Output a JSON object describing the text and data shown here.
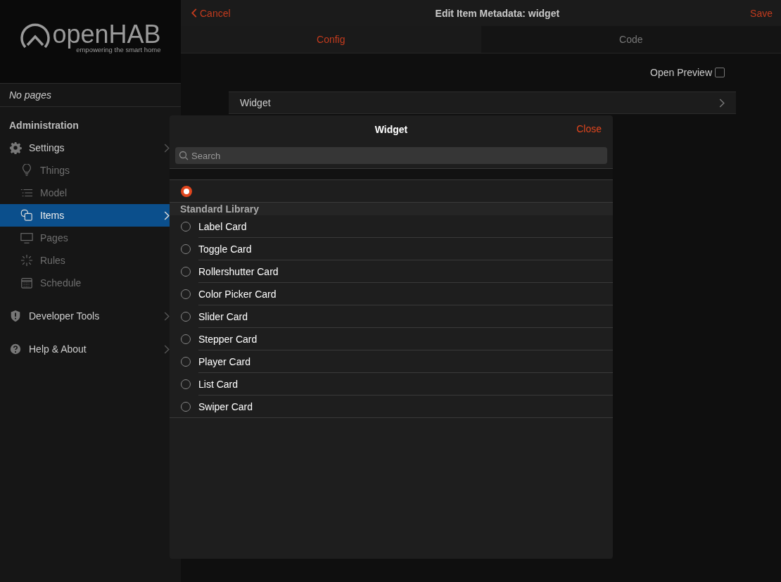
{
  "sidebar": {
    "logo": {
      "name": "openHAB",
      "tagline": "empowering the smart home"
    },
    "pages_note": "No pages",
    "section": "Administration",
    "items": [
      {
        "label": "Settings",
        "selected": false,
        "children": [
          {
            "label": "Things",
            "selected": false
          },
          {
            "label": "Model",
            "selected": false
          },
          {
            "label": "Items",
            "selected": true
          },
          {
            "label": "Pages",
            "selected": false
          },
          {
            "label": "Rules",
            "selected": false
          },
          {
            "label": "Schedule",
            "selected": false
          }
        ]
      },
      {
        "label": "Developer Tools",
        "selected": false
      },
      {
        "label": "Help & About",
        "selected": false
      }
    ]
  },
  "navbar": {
    "back": "Cancel",
    "title": "Edit Item Metadata: widget",
    "action": "Save"
  },
  "tabs": [
    {
      "label": "Config",
      "selected": true
    },
    {
      "label": "Code",
      "selected": false
    }
  ],
  "preview": {
    "label": "Open Preview",
    "checked": false
  },
  "widget_row": {
    "label": "Widget"
  },
  "popup": {
    "title": "Widget",
    "close": "Close",
    "search": {
      "placeholder": "Search"
    },
    "options": [
      {
        "selected": true
      }
    ],
    "groups": [
      {
        "title": "Standard Library",
        "options": [
          {
            "label": "Label Card",
            "selected": false
          },
          {
            "label": "Toggle Card",
            "selected": false
          },
          {
            "label": "Rollershutter Card",
            "selected": false
          },
          {
            "label": "Color Picker Card",
            "selected": false
          },
          {
            "label": "Slider Card",
            "selected": false
          },
          {
            "label": "Stepper Card",
            "selected": false
          },
          {
            "label": "Player Card",
            "selected": false
          },
          {
            "label": "List Card",
            "selected": false
          },
          {
            "label": "Swiper Card",
            "selected": false
          }
        ]
      }
    ]
  }
}
